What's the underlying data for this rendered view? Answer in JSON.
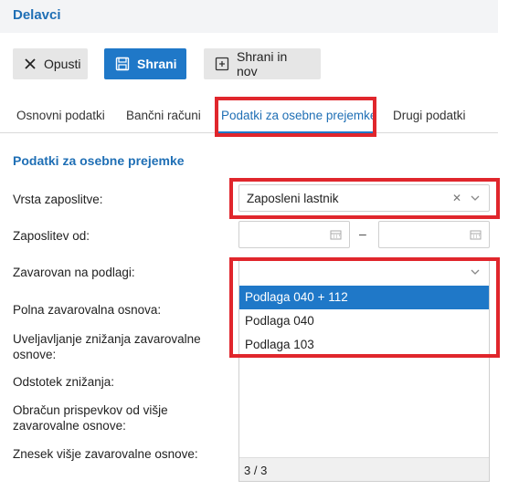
{
  "app": {
    "title": "Delavci"
  },
  "toolbar": {
    "cancel_label": "Opusti",
    "save_label": "Shrani",
    "save_new_label": "Shrani in nov"
  },
  "tabs": [
    {
      "label": "Osnovni podatki",
      "active": false
    },
    {
      "label": "Bančni računi",
      "active": false
    },
    {
      "label": "Podatki za osebne prejemke",
      "active": true
    },
    {
      "label": "Drugi podatki",
      "active": false
    }
  ],
  "section": {
    "title": "Podatki za osebne prejemke"
  },
  "form": {
    "employment_type": {
      "label": "Vrsta zaposlitve:",
      "value": "Zaposleni lastnik"
    },
    "employment_from": {
      "label": "Zaposlitev od:"
    },
    "insured_basis": {
      "label": "Zavarovan na podlagi:",
      "value": ""
    },
    "full_base": {
      "label": "Polna zavarovalna osnova:"
    },
    "reduction_claim": {
      "label": "Uveljavljanje znižanja zavarovalne osnove:"
    },
    "reduction_percent": {
      "label": "Odstotek znižanja:"
    },
    "higher_calc": {
      "label": "Obračun prispevkov od višje zavarovalne osnove:"
    },
    "higher_amount": {
      "label": "Znesek višje zavarovalne osnove:"
    }
  },
  "dropdown": {
    "options": [
      {
        "label": "Podlaga 040 + 112",
        "selected": true
      },
      {
        "label": "Podlaga 040",
        "selected": false
      },
      {
        "label": "Podlaga 103",
        "selected": false
      }
    ],
    "count_label": "3 / 3"
  },
  "colors": {
    "accent": "#1f78c8",
    "title": "#1f6fb5",
    "highlight": "#e0262c"
  }
}
